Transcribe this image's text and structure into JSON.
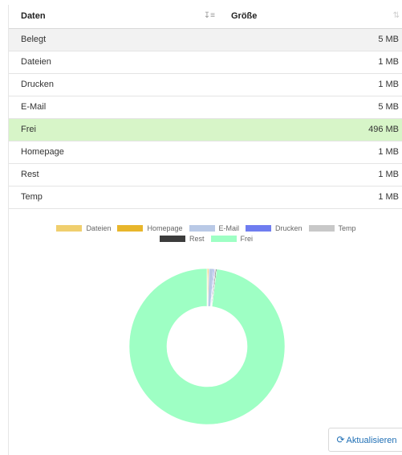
{
  "table": {
    "headers": {
      "name": "Daten",
      "size": "Größe"
    },
    "rows": [
      {
        "name": "Belegt",
        "size": "5 MB"
      },
      {
        "name": "Dateien",
        "size": "1 MB"
      },
      {
        "name": "Drucken",
        "size": "1 MB"
      },
      {
        "name": "E-Mail",
        "size": "5 MB"
      },
      {
        "name": "Frei",
        "size": "496 MB"
      },
      {
        "name": "Homepage",
        "size": "1 MB"
      },
      {
        "name": "Rest",
        "size": "1 MB"
      },
      {
        "name": "Temp",
        "size": "1 MB"
      }
    ]
  },
  "chart_data": {
    "type": "pie",
    "donut": true,
    "legend_position": "top",
    "labels": [
      "Dateien",
      "Homepage",
      "E-Mail",
      "Drucken",
      "Temp",
      "Rest",
      "Frei"
    ],
    "values": [
      1,
      1,
      5,
      1,
      1,
      1,
      496
    ],
    "colors": [
      "#f0cf6e",
      "#e8b62b",
      "#b9c9e6",
      "#6f7df0",
      "#c8c8c8",
      "#3c3c3c",
      "#9effc4"
    ]
  },
  "refresh_button": {
    "icon": "refresh-icon",
    "label": "Aktualisieren"
  }
}
